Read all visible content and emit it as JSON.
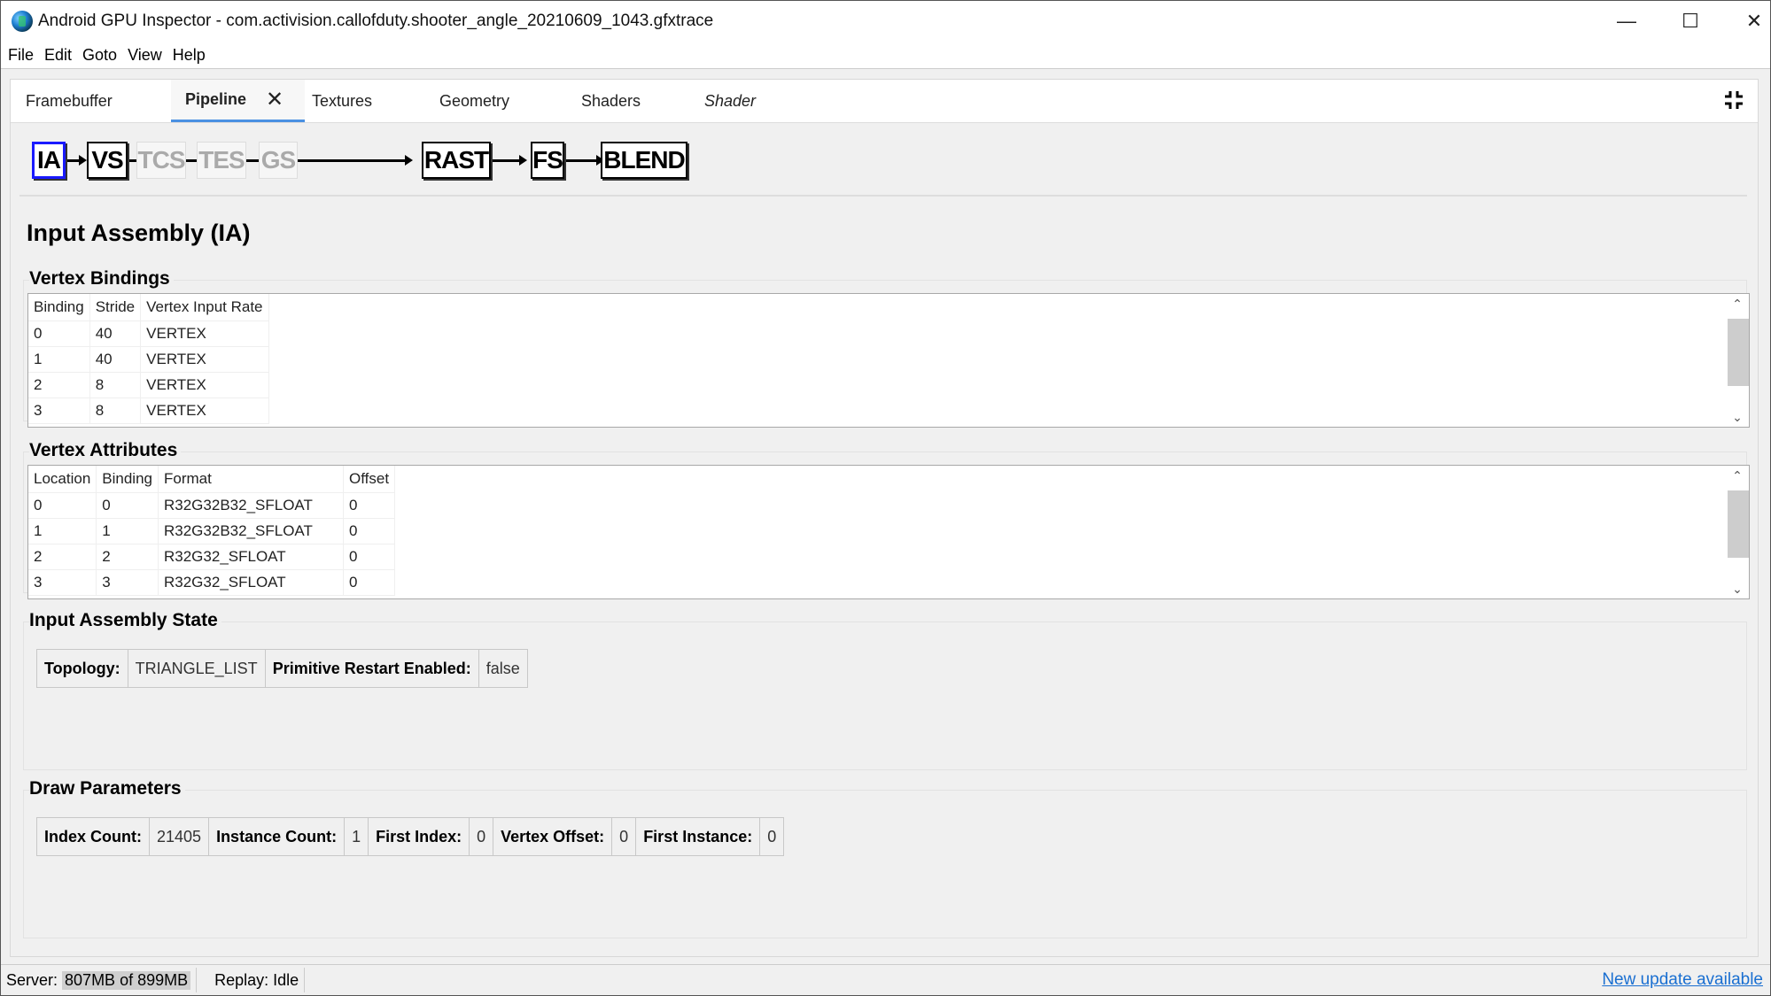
{
  "window": {
    "title": "Android GPU Inspector - com.activision.callofduty.shooter_angle_20210609_1043.gfxtrace",
    "minimize_glyph": "—",
    "maximize_glyph": "☐",
    "close_glyph": "✕"
  },
  "menu": [
    "File",
    "Edit",
    "Goto",
    "View",
    "Help"
  ],
  "tabs": [
    {
      "label": "Framebuffer",
      "active": false
    },
    {
      "label": "Pipeline",
      "active": true,
      "closable": true,
      "close_glyph": "✕"
    },
    {
      "label": "Textures",
      "active": false
    },
    {
      "label": "Geometry",
      "active": false
    },
    {
      "label": "Shaders",
      "active": false
    },
    {
      "label": "Shader",
      "active": false,
      "italic": true
    }
  ],
  "pipeline_stages": [
    {
      "label": "IA",
      "state": "selected"
    },
    {
      "label": "VS",
      "state": "enabled"
    },
    {
      "label": "TCS",
      "state": "disabled"
    },
    {
      "label": "TES",
      "state": "disabled"
    },
    {
      "label": "GS",
      "state": "disabled"
    },
    {
      "label": "RAST",
      "state": "enabled"
    },
    {
      "label": "FS",
      "state": "enabled"
    },
    {
      "label": "BLEND",
      "state": "enabled"
    }
  ],
  "page_title": "Input Assembly (IA)",
  "vertex_bindings": {
    "title": "Vertex Bindings",
    "columns": [
      "Binding",
      "Stride",
      "Vertex Input Rate"
    ],
    "rows": [
      [
        "0",
        "40",
        "VERTEX"
      ],
      [
        "1",
        "40",
        "VERTEX"
      ],
      [
        "2",
        "8",
        "VERTEX"
      ],
      [
        "3",
        "8",
        "VERTEX"
      ]
    ]
  },
  "vertex_attributes": {
    "title": "Vertex Attributes",
    "columns": [
      "Location",
      "Binding",
      "Format",
      "Offset"
    ],
    "rows": [
      [
        "0",
        "0",
        "R32G32B32_SFLOAT",
        "0"
      ],
      [
        "1",
        "1",
        "R32G32B32_SFLOAT",
        "0"
      ],
      [
        "2",
        "2",
        "R32G32_SFLOAT",
        "0"
      ],
      [
        "3",
        "3",
        "R32G32_SFLOAT",
        "0"
      ]
    ]
  },
  "input_assembly_state": {
    "title": "Input Assembly State",
    "topology_label": "Topology:",
    "topology_value": "TRIANGLE_LIST",
    "restart_label": "Primitive Restart Enabled:",
    "restart_value": "false"
  },
  "draw_parameters": {
    "title": "Draw Parameters",
    "index_count_label": "Index Count:",
    "index_count": "21405",
    "instance_count_label": "Instance Count:",
    "instance_count": "1",
    "first_index_label": "First Index:",
    "first_index": "0",
    "vertex_offset_label": "Vertex Offset:",
    "vertex_offset": "0",
    "first_instance_label": "First Instance:",
    "first_instance": "0"
  },
  "scroll_glyphs": {
    "up": "⌃",
    "down": "⌄"
  },
  "status": {
    "server_label": "Server:",
    "server_value": "807MB of 899MB",
    "replay": "Replay: Idle",
    "update_link": "New update available"
  }
}
